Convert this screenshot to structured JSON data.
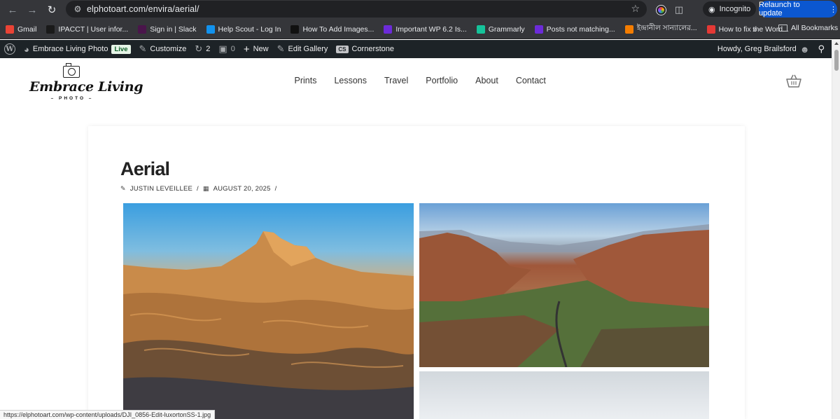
{
  "browser": {
    "url": "elphotoart.com/envira/aerial/",
    "incognito_label": "Incognito",
    "relaunch_label": "Relaunch to update",
    "status_url": "https://elphotoart.com/wp-content/uploads/DJI_0856-Edit-luxortonSS-1.jpg"
  },
  "bookmarks": [
    {
      "label": "Gmail",
      "icon": "gmail-icon",
      "color": "#ea4335"
    },
    {
      "label": "IPACCT | User infor...",
      "icon": "ipacct-icon",
      "color": "#1a1a1a"
    },
    {
      "label": "Sign in | Slack",
      "icon": "slack-icon",
      "color": "#4a154b"
    },
    {
      "label": "Help Scout - Log In",
      "icon": "helpscout-icon",
      "color": "#1292ee"
    },
    {
      "label": "How To Add Images...",
      "icon": "squarespace-icon",
      "color": "#111111"
    },
    {
      "label": "Important WP 6.2 Is...",
      "icon": "t-icon",
      "color": "#6c2bd9"
    },
    {
      "label": "Grammarly",
      "icon": "grammarly-icon",
      "color": "#15c39a"
    },
    {
      "label": "Posts not matching...",
      "icon": "t-icon",
      "color": "#6c2bd9"
    },
    {
      "label": "ইন্দ্রানীল সান্যালের...",
      "icon": "blogger-icon",
      "color": "#f57d00"
    },
    {
      "label": "How to fix the Word...",
      "icon": "bookmark-site-icon",
      "color": "#e53935"
    }
  ],
  "all_bookmarks_label": "All Bookmarks",
  "wpbar": {
    "site_name": "Embrace Living Photo",
    "live_badge": "Live",
    "customize": "Customize",
    "updates_count": "2",
    "comments_count": "0",
    "new": "New",
    "edit_gallery": "Edit Gallery",
    "cs_badge": "CS",
    "cornerstone": "Cornerstone",
    "howdy": "Howdy, Greg Brailsford"
  },
  "site": {
    "logo_text": "Embrace Living",
    "logo_sub": "PHOTO",
    "nav": [
      "Prints",
      "Lessons",
      "Travel",
      "Portfolio",
      "About",
      "Contact"
    ]
  },
  "post": {
    "title": "Aerial",
    "author": "JUSTIN LEVEILLEE",
    "date": "AUGUST 20, 2025",
    "separator": "/"
  }
}
